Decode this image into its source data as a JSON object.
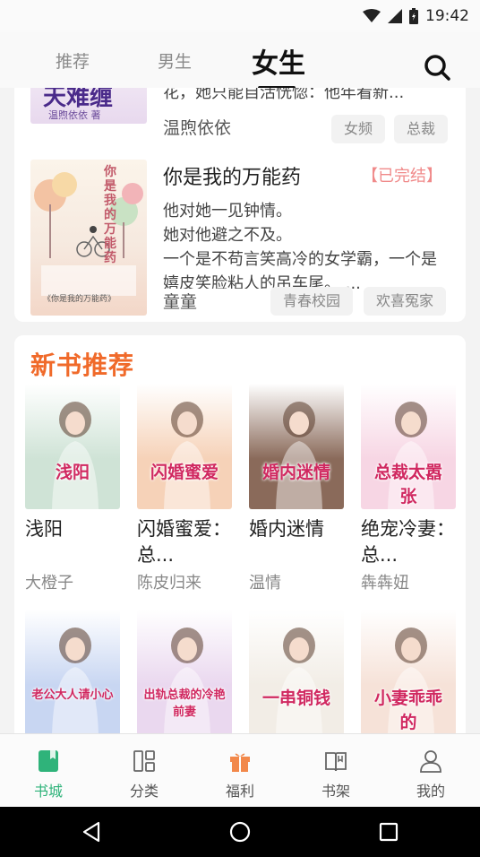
{
  "status_bar": {
    "time": "19:42"
  },
  "top_tabs": [
    {
      "label": "推荐"
    },
    {
      "label": "男生"
    },
    {
      "label": "女生",
      "active": true
    }
  ],
  "list_items": [
    {
      "cover_text": "天难缠",
      "cover_author": "温煦依依 著",
      "desc_fragment": "花，她只能自活恍惚：他年看新...",
      "author": "温煦依依",
      "tags": [
        "女频",
        "总裁"
      ]
    },
    {
      "title": "你是我的万能药",
      "status": "【已完结】",
      "cover_text": "你是我的万能药",
      "cover_caption": "《你是我的万能药》",
      "desc": "他对她一见钟情。\n她对他避之不及。\n一个是不苟言笑高冷的女学霸，一个是嬉皮笑脸粘人的吊车尾。 ...",
      "author": "童童",
      "tags": [
        "青春校园",
        "欢喜冤家"
      ]
    }
  ],
  "new_books": {
    "section_title": "新书推荐",
    "books": [
      {
        "title": "浅阳",
        "author": "大橙子",
        "cover_text": "浅阳",
        "cover_color": "#cfe3d6"
      },
      {
        "title": "闪婚蜜爱：总...",
        "author": "陈皮归来",
        "cover_text": "闪婚蜜爱",
        "cover_color": "#f6d2b8"
      },
      {
        "title": "婚内迷情",
        "author": "温情",
        "cover_text": "婚内迷情",
        "cover_color": "#8a6a5a"
      },
      {
        "title": "绝宠冷妻：总...",
        "author": "犇犇妞",
        "cover_text": "总裁太嚣张",
        "cover_color": "#f7d6e4"
      },
      {
        "title": "",
        "author": "",
        "cover_text": "老公大人请小心",
        "cover_color": "#c8d6f2"
      },
      {
        "title": "",
        "author": "",
        "cover_text": "出轨总裁的冷艳前妻",
        "cover_color": "#ead8ef"
      },
      {
        "title": "",
        "author": "",
        "cover_text": "一串铜钱",
        "cover_color": "#f2ede6"
      },
      {
        "title": "",
        "author": "",
        "cover_text": "小妻乖乖的",
        "cover_color": "#f6e2d8"
      }
    ]
  },
  "bottom_nav": [
    {
      "label": "书城",
      "icon": "bookstore-icon",
      "active": true
    },
    {
      "label": "分类",
      "icon": "category-icon"
    },
    {
      "label": "福利",
      "icon": "gift-icon"
    },
    {
      "label": "书架",
      "icon": "bookshelf-icon"
    },
    {
      "label": "我的",
      "icon": "profile-icon"
    }
  ],
  "colors": {
    "accent_green": "#2fb37a",
    "section_orange": "#f06a2a",
    "status_pink": "#f08a8a",
    "gift_orange": "#f2884a"
  }
}
